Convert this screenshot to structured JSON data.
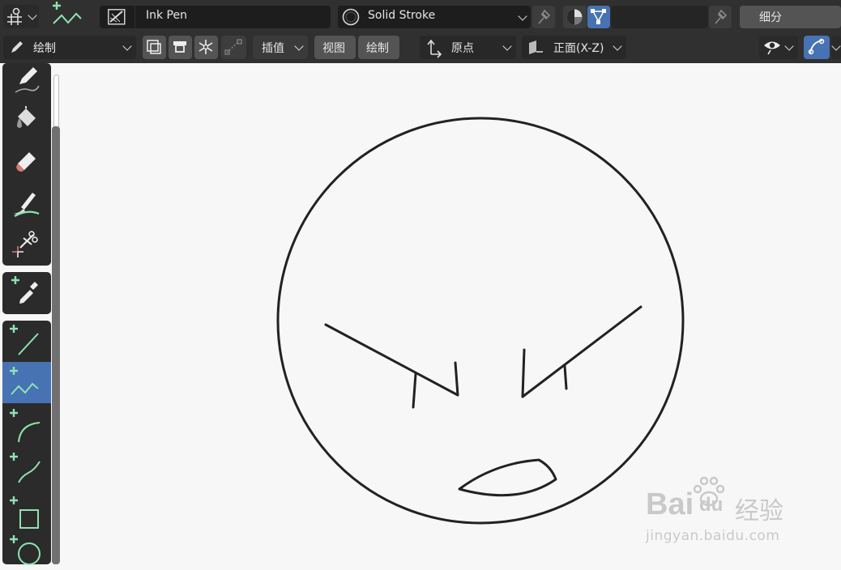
{
  "header": {
    "brush_name": "Ink Pen",
    "material_name": "Solid Stroke",
    "subdivide_label": "细分"
  },
  "toolbar2": {
    "mode_label": "绘制",
    "interp_label": "插值",
    "view_label": "视图",
    "draw_label": "绘制",
    "origin_label": "原点",
    "plane_label": "正面(X-Z)"
  },
  "watermark": {
    "brand": "Bai",
    "brand2": "du",
    "site_name": "经验",
    "url": "jingyan.baidu.com"
  },
  "colors": {
    "accent": "#4772b3",
    "add_icon": "#8ee3b0",
    "header_bg": "#303030",
    "canvas_bg": "#f7f7f7"
  },
  "icons": [
    "pencil-icon",
    "bucket-icon",
    "eraser-icon",
    "tint-icon",
    "cutter-icon",
    "eyedropper-icon",
    "line-icon",
    "polyline-icon",
    "arc-icon",
    "curve-icon",
    "box-icon",
    "circle-icon"
  ]
}
